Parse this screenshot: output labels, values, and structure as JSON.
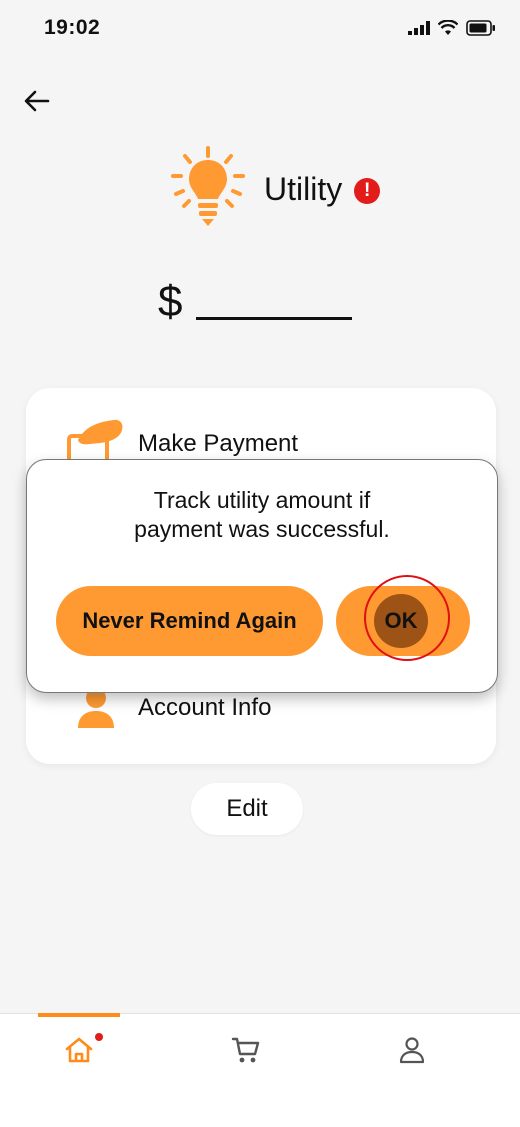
{
  "status_bar": {
    "time": "19:02"
  },
  "header": {
    "title": "Utility",
    "alert_glyph": "!"
  },
  "amount": {
    "currency": "$"
  },
  "menu": {
    "items": [
      {
        "label": "Make Payment",
        "icon": "hand-payment-icon"
      },
      {
        "label": "Account Info",
        "icon": "person-icon"
      }
    ]
  },
  "dialog": {
    "message_line1": "Track utility amount if",
    "message_line2": "payment was successful.",
    "never_label": "Never Remind Again",
    "ok_label": "OK"
  },
  "edit_label": "Edit",
  "bottom_nav": {
    "items": [
      {
        "icon": "home-icon",
        "active": true
      },
      {
        "icon": "cart-icon",
        "active": false
      },
      {
        "icon": "profile-icon",
        "active": false
      }
    ]
  },
  "colors": {
    "accent": "#ff9a33",
    "alert": "#e21b1b",
    "ok_pressed": "#9c5315"
  }
}
